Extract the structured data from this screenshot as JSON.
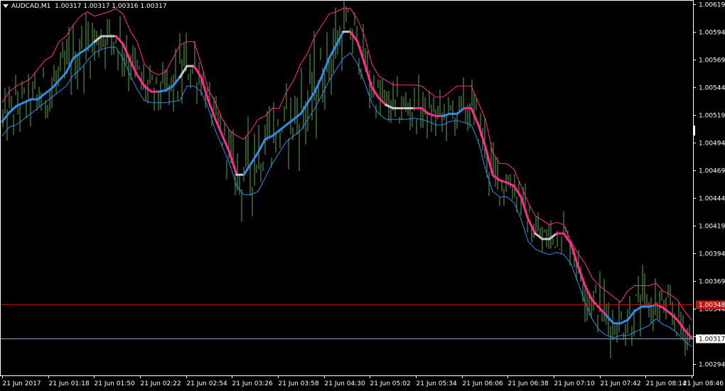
{
  "header": {
    "symbol": "AUDCAD,M1",
    "ohlc": "1.00317 1.00317 1.00316 1.00317"
  },
  "colors": {
    "background": "#000000",
    "price_bars": "#5fa84a",
    "mid_up": "#2e8de6",
    "mid_down": "#ff2d8c",
    "mid_flat": "#c8c8c8",
    "upper_band": "#ff2d8c",
    "lower_band": "#2e8de6",
    "ask_line": "#d01010",
    "bid_line": "#8fa3b8",
    "grid_text": "#ffffff"
  },
  "chart_data": {
    "type": "line",
    "title": "AUDCAD,M1",
    "ylim": [
      1.00284,
      1.00622
    ],
    "y_ticks": [
      "1.00619",
      "1.00594",
      "1.00569",
      "1.00544",
      "1.00519",
      "1.00494",
      "1.00469",
      "1.00444",
      "1.00419",
      "1.00394",
      "1.00369",
      "1.00344",
      "1.00319",
      "1.00294"
    ],
    "x_ticks": [
      "21 Jun 2017",
      "21 Jun 01:18",
      "21 Jun 01:50",
      "21 Jun 02:22",
      "21 Jun 02:54",
      "21 Jun 03:26",
      "21 Jun 03:58",
      "21 Jun 04:30",
      "21 Jun 05:02",
      "21 Jun 05:34",
      "21 Jun 06:06",
      "21 Jun 06:38",
      "21 Jun 07:10",
      "21 Jun 07:42",
      "21 Jun 08:14",
      "21 Jun 08:46"
    ],
    "ask_price": {
      "label": "1.00348",
      "value": 1.00348
    },
    "bid_price": {
      "label": "1.00317",
      "value": 1.00317
    },
    "series": [
      {
        "name": "mid",
        "t": [
          0,
          10,
          20,
          30,
          40,
          50,
          60,
          70,
          80,
          90,
          100,
          110,
          120,
          130,
          140,
          150,
          160,
          170,
          180,
          190,
          200,
          210,
          220,
          230,
          240,
          250,
          260,
          270,
          280,
          290,
          300,
          310,
          320,
          330,
          340,
          350,
          360,
          370,
          380,
          390,
          400,
          410,
          420,
          430,
          440,
          450,
          460,
          470,
          480,
          490,
          500,
          510,
          520,
          530,
          540,
          550,
          560,
          570,
          580,
          590,
          600,
          610,
          620,
          630,
          640,
          650,
          660,
          670,
          680,
          690,
          700,
          710,
          720,
          730,
          740,
          750,
          760,
          770,
          780,
          790,
          800,
          810,
          820,
          830,
          840,
          850,
          860,
          870,
          880,
          890,
          900,
          910,
          920,
          930,
          940,
          950,
          960,
          970
        ],
        "v": [
          1.00513,
          1.00521,
          1.00527,
          1.0053,
          1.00533,
          1.00533,
          1.00538,
          1.00543,
          1.0055,
          1.00557,
          1.0057,
          1.00575,
          1.00579,
          1.00585,
          1.0059,
          1.0059,
          1.0059,
          1.00583,
          1.00568,
          1.00555,
          1.00545,
          1.0054,
          1.0054,
          1.00541,
          1.00545,
          1.00553,
          1.00563,
          1.00563,
          1.00553,
          1.00532,
          1.00515,
          1.005,
          1.00485,
          1.00465,
          1.00465,
          1.00475,
          1.00485,
          1.00497,
          1.005,
          1.00505,
          1.0051,
          1.00515,
          1.0052,
          1.0053,
          1.0054,
          1.00554,
          1.0057,
          1.00582,
          1.00594,
          1.00594,
          1.00585,
          1.00565,
          1.00544,
          1.00534,
          1.00528,
          1.00525,
          1.00525,
          1.00525,
          1.00525,
          1.00525,
          1.0052,
          1.00518,
          1.00518,
          1.0052,
          1.0052,
          1.00525,
          1.00525,
          1.0051,
          1.0049,
          1.00465,
          1.0046,
          1.00458,
          1.00455,
          1.00445,
          1.00425,
          1.00412,
          1.00407,
          1.00407,
          1.00412,
          1.00412,
          1.00403,
          1.00383,
          1.00365,
          1.00352,
          1.00345,
          1.00338,
          1.00331,
          1.00331,
          1.00334,
          1.00342,
          1.00346,
          1.00346,
          1.00348,
          1.00345,
          1.0034,
          1.00334,
          1.00325,
          1.00318
        ],
        "dir": [
          "u",
          "u",
          "u",
          "u",
          "u",
          "u",
          "u",
          "u",
          "u",
          "u",
          "u",
          "u",
          "u",
          "u",
          "f",
          "f",
          "f",
          "d",
          "d",
          "d",
          "d",
          "d",
          "d",
          "u",
          "u",
          "u",
          "f",
          "f",
          "d",
          "d",
          "d",
          "d",
          "d",
          "d",
          "f",
          "u",
          "u",
          "u",
          "u",
          "u",
          "u",
          "u",
          "u",
          "u",
          "u",
          "u",
          "u",
          "u",
          "u",
          "f",
          "d",
          "d",
          "d",
          "d",
          "d",
          "f",
          "f",
          "f",
          "f",
          "d",
          "d",
          "d",
          "d",
          "u",
          "u",
          "u",
          "d",
          "d",
          "d",
          "d",
          "d",
          "d",
          "d",
          "d",
          "d",
          "d",
          "f",
          "f",
          "f",
          "d",
          "d",
          "d",
          "d",
          "d",
          "d",
          "d",
          "u",
          "u",
          "u",
          "u",
          "u",
          "u",
          "u",
          "d",
          "d",
          "d",
          "d",
          "d"
        ]
      },
      {
        "name": "upper",
        "v": [
          1.0053,
          1.0054,
          1.00545,
          1.00548,
          1.00552,
          1.0056,
          1.00568,
          1.00572,
          1.00585,
          1.0059,
          1.006,
          1.00608,
          1.00612,
          1.00608,
          1.0061,
          1.00612,
          1.00615,
          1.0061,
          1.00595,
          1.00585,
          1.00565,
          1.00558,
          1.00555,
          1.00558,
          1.0057,
          1.00582,
          1.00585,
          1.00585,
          1.00565,
          1.00542,
          1.0053,
          1.00515,
          1.00505,
          1.005,
          1.00497,
          1.00505,
          1.00515,
          1.00518,
          1.00525,
          1.00525,
          1.0054,
          1.0055,
          1.00565,
          1.00575,
          1.0059,
          1.006,
          1.0061,
          1.00612,
          1.00615,
          1.00615,
          1.00605,
          1.0059,
          1.00565,
          1.00554,
          1.0055,
          1.00546,
          1.00546,
          1.00546,
          1.00546,
          1.00545,
          1.0054,
          1.00535,
          1.00535,
          1.0054,
          1.00545,
          1.00545,
          1.00545,
          1.0053,
          1.00515,
          1.00485,
          1.00475,
          1.00475,
          1.0047,
          1.00455,
          1.0044,
          1.00428,
          1.00424,
          1.0042,
          1.00422,
          1.0042,
          1.00405,
          1.00394,
          1.00385,
          1.00372,
          1.00365,
          1.0036,
          1.00355,
          1.0035,
          1.0036,
          1.00365,
          1.00365,
          1.00365,
          1.00367,
          1.0036,
          1.00357,
          1.00352,
          1.00342,
          1.00334
        ]
      },
      {
        "name": "lower",
        "v": [
          1.005,
          1.00508,
          1.0051,
          1.00515,
          1.0052,
          1.00525,
          1.0053,
          1.00535,
          1.0054,
          1.00545,
          1.00555,
          1.0056,
          1.00568,
          1.00575,
          1.00578,
          1.0058,
          1.0058,
          1.0057,
          1.00555,
          1.00542,
          1.00532,
          1.0053,
          1.0053,
          1.0053,
          1.00531,
          1.00532,
          1.00545,
          1.00545,
          1.0054,
          1.00525,
          1.00505,
          1.0049,
          1.00475,
          1.00455,
          1.00447,
          1.00447,
          1.0045,
          1.00462,
          1.00475,
          1.00485,
          1.00495,
          1.005,
          1.00505,
          1.00515,
          1.00525,
          1.00537,
          1.0055,
          1.0056,
          1.0057,
          1.00575,
          1.00565,
          1.00548,
          1.0053,
          1.0052,
          1.00515,
          1.00515,
          1.00515,
          1.00515,
          1.00516,
          1.00515,
          1.00513,
          1.0051,
          1.0051,
          1.00513,
          1.00514,
          1.00512,
          1.0051,
          1.00495,
          1.0047,
          1.0045,
          1.00445,
          1.00445,
          1.0044,
          1.00425,
          1.00405,
          1.00398,
          1.00395,
          1.00393,
          1.00395,
          1.00393,
          1.00385,
          1.00368,
          1.0035,
          1.00335,
          1.00325,
          1.0032,
          1.00318,
          1.0032,
          1.0032,
          1.00323,
          1.00326,
          1.00329,
          1.00335,
          1.0033,
          1.00327,
          1.00322,
          1.00315,
          1.0031
        ]
      }
    ]
  }
}
